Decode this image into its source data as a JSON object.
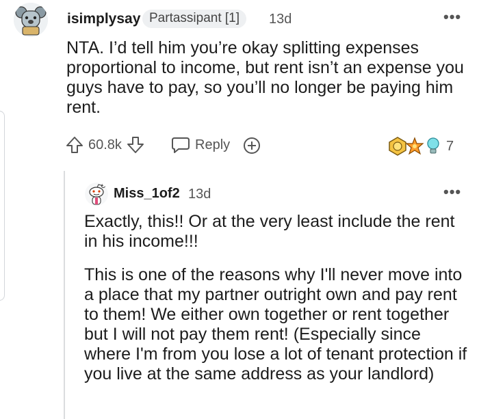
{
  "comment": {
    "username": "isimplysay",
    "flair": "Partassipant [1]",
    "time": "13d",
    "body": "NTA. I’d tell him you’re okay splitting expenses proportional to income, but rent isn’t an expense you guys have to pay, so you’ll no longer be paying him rent.",
    "vote_count": "60.8k",
    "reply_label": "Reply",
    "award_count": "7"
  },
  "reply": {
    "username": "Miss_1of2",
    "time": "13d",
    "paragraphs": [
      "Exactly, this!! Or at the very least include the rent in his income!!!",
      "This is one of the reasons why I'll never move into a place that my partner outright own and pay rent to them! We either own together or rent together but I will not pay them rent! (Especially since where I'm from you lose a lot of tenant protection if you live at the same address as your landlord)"
    ]
  },
  "icons": {
    "more": "more-options-icon",
    "upvote": "upvote-arrow-icon",
    "downvote": "downvote-arrow-icon",
    "reply": "chat-bubble-icon",
    "award": "plus-circle-icon"
  },
  "colors": {
    "text": "#1c1c1c",
    "muted": "#555555",
    "flair_bg": "#eef0f2",
    "thread_line": "#dadcde"
  }
}
